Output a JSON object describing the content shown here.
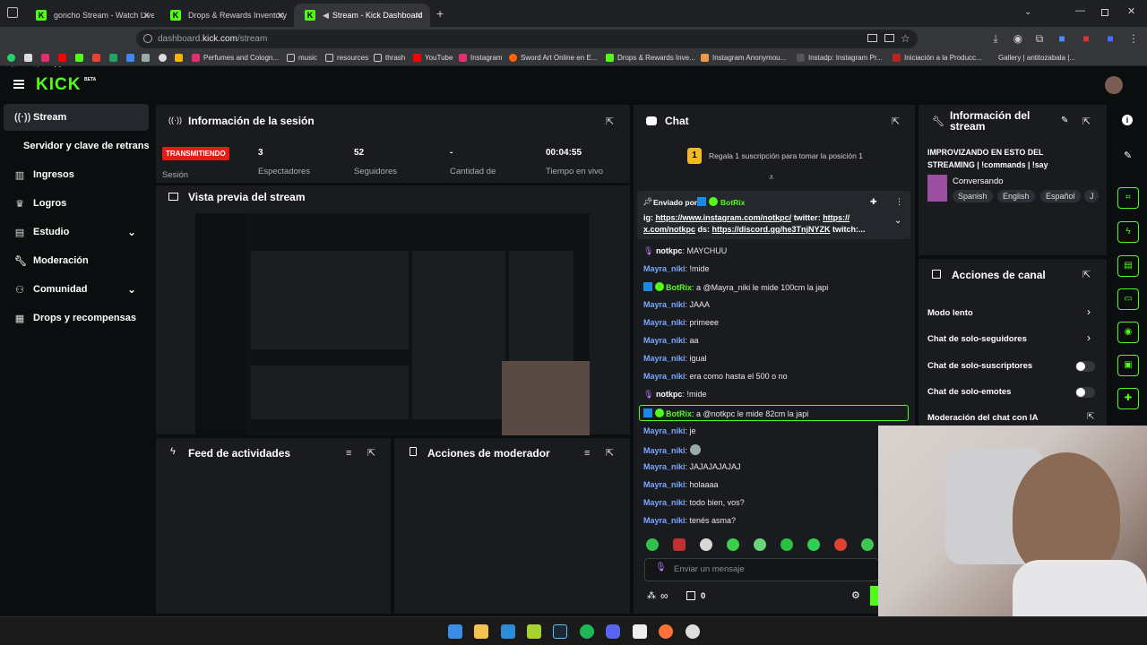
{
  "browser": {
    "tabs": [
      {
        "title": "goncho Stream - Watch Live on",
        "active": false
      },
      {
        "title": "Drops & Rewards Inventory - K",
        "active": false
      },
      {
        "title": "Stream - Kick Dashboard",
        "active": true
      }
    ],
    "url_domain": "dashboard.",
    "url_host": "kick.com",
    "url_path": "/stream",
    "bookmarks": [
      "Perfumes and Cologn...",
      "music",
      "resources",
      "thrash",
      "YouTube",
      "Instagram",
      "Sword Art Online en E...",
      "Drops & Rewards Inve...",
      "Instagram Anonymou...",
      "Instadp: Instagram Pr...",
      "Iniciación a la Producc...",
      "Gallery | antitozabala |..."
    ]
  },
  "app": {
    "logo": "KICK",
    "logo_badge": "BETA"
  },
  "sidebar": {
    "items": [
      {
        "label": "Stream",
        "icon": "broadcast-icon"
      },
      {
        "label": "Servidor y clave de retransm",
        "icon": ""
      },
      {
        "label": "Ingresos",
        "icon": "chart-icon"
      },
      {
        "label": "Logros",
        "icon": "trophy-icon"
      },
      {
        "label": "Estudio",
        "icon": "studio-icon"
      },
      {
        "label": "Moderación",
        "icon": "wrench-icon"
      },
      {
        "label": "Comunidad",
        "icon": "people-icon"
      },
      {
        "label": "Drops y recompensas",
        "icon": "gift-icon"
      }
    ]
  },
  "session": {
    "title": "Información de la sesión",
    "status": "TRANSMITIENDO",
    "session_label": "Sesión",
    "viewers_value": "3",
    "viewers_label": "Espectadores",
    "followers_value": "52",
    "followers_label": "Seguidores",
    "amount_value": "-",
    "amount_label": "Cantidad de",
    "live_value": "00:04:55",
    "live_label": "Tiempo en vivo"
  },
  "preview": {
    "title": "Vista previa del stream"
  },
  "activity": {
    "title": "Feed de actividades"
  },
  "modactions": {
    "title": "Acciones de moderador"
  },
  "chat": {
    "title": "Chat",
    "sub_banner": "Regala 1 suscripción para tomar la posición 1",
    "sub_rank": "1",
    "pinned_by": "Enviado por",
    "pinned_user": "BotRix",
    "pinned_text_1a": "ig: ",
    "pinned_link_1": "https://www.instagram.com/notkpc/",
    "pinned_text_1b": " twitter: ",
    "pinned_link_2": "https://",
    "pinned_link_3": "x.com/notkpc",
    "pinned_text_2": " ds: ",
    "pinned_link_4": "https://discord.gg/he3TnjNYZK",
    "pinned_text_3": " twitch:...",
    "messages": [
      {
        "user": "notkpc",
        "text": ": MAYCHUU"
      },
      {
        "user": "Mayra_niki",
        "text": ": !mide"
      },
      {
        "user": "BotRix",
        "text": ": a @Mayra_niki le mide 100cm la japi"
      },
      {
        "user": "Mayra_niki",
        "text": ": JAAA"
      },
      {
        "user": "Mayra_niki",
        "text": ": primeee"
      },
      {
        "user": "Mayra_niki",
        "text": ": aa"
      },
      {
        "user": "Mayra_niki",
        "text": ": igual"
      },
      {
        "user": "Mayra_niki",
        "text": ": era como hasta el 500 o no"
      },
      {
        "user": "notkpc",
        "text": ": !mide"
      },
      {
        "user": "BotRix",
        "text": ": a @notkpc le mide 82cm la japi"
      },
      {
        "user": "Mayra_niki",
        "text": ": je"
      },
      {
        "user": "Mayra_niki",
        "text": ":"
      },
      {
        "user": "Mayra_niki",
        "text": ": JAJAJAJAJAJ"
      },
      {
        "user": "Mayra_niki",
        "text": ": holaaaa"
      },
      {
        "user": "Mayra_niki",
        "text": ": todo bien, vos?"
      },
      {
        "user": "Mayra_niki",
        "text": ": tenés asma?"
      }
    ],
    "input_placeholder": "Enviar un mensaje",
    "infinity": "∞",
    "gift_count": "0"
  },
  "stream_info": {
    "title": "Información del stream",
    "stream_title_1": "IMPROVIZANDO EN ESTO DEL",
    "stream_title_2": "STREAMING | !commands | !say",
    "category": "Conversando",
    "tags": [
      "Spanish",
      "English",
      "Español",
      "J"
    ]
  },
  "channel_actions": {
    "title": "Acciones de canal",
    "items": [
      "Modo lento",
      "Chat de solo-seguidores",
      "Chat de solo-suscriptores",
      "Chat de solo-emotes",
      "Moderación del chat con IA"
    ]
  },
  "colors": {
    "accent": "#53fc18",
    "live": "#e91916",
    "panel": "#191b1f",
    "bg": "#0b0e0f"
  }
}
